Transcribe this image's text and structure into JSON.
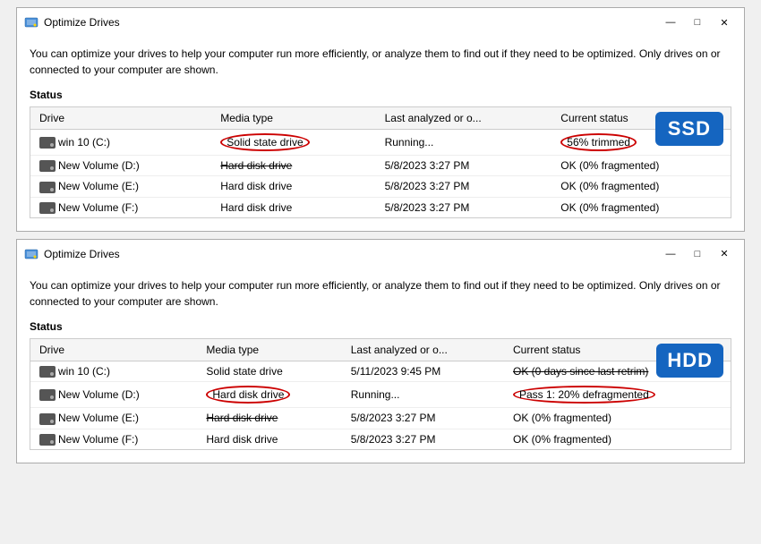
{
  "window1": {
    "title": "Optimize Drives",
    "description": "You can optimize your drives to help your computer run more efficiently, or analyze them to find out if they need to be optimized. Only drives on or connected to your computer are shown.",
    "section_label": "Status",
    "badge": "SSD",
    "columns": [
      "Drive",
      "Media type",
      "Last analyzed or o...",
      "Current status"
    ],
    "rows": [
      {
        "drive": "win 10 (C:)",
        "media_type": "Solid state drive",
        "last_analyzed": "Running...",
        "current_status": "56% trimmed",
        "circle_media": true,
        "circle_status": true
      },
      {
        "drive": "New Volume (D:)",
        "media_type": "Hard disk drive",
        "last_analyzed": "5/8/2023 3:27 PM",
        "current_status": "OK (0% fragmented)",
        "strikethrough_media": true,
        "circle_media": false,
        "circle_status": false
      },
      {
        "drive": "New Volume (E:)",
        "media_type": "Hard disk drive",
        "last_analyzed": "5/8/2023 3:27 PM",
        "current_status": "OK (0% fragmented)"
      },
      {
        "drive": "New Volume (F:)",
        "media_type": "Hard disk drive",
        "last_analyzed": "5/8/2023 3:27 PM",
        "current_status": "OK (0% fragmented)"
      }
    ]
  },
  "window2": {
    "title": "Optimize Drives",
    "description": "You can optimize your drives to help your computer run more efficiently, or analyze them to find out if they need to be optimized. Only drives on or connected to your computer are shown.",
    "section_label": "Status",
    "badge": "HDD",
    "columns": [
      "Drive",
      "Media type",
      "Last analyzed or o...",
      "Current status"
    ],
    "rows": [
      {
        "drive": "win 10 (C:)",
        "media_type": "Solid state drive",
        "last_analyzed": "5/11/2023 9:45 PM",
        "current_status": "OK (0 days since last retrim)",
        "strikethrough_status": true
      },
      {
        "drive": "New Volume (D:)",
        "media_type": "Hard disk drive",
        "last_analyzed": "Running...",
        "current_status": "Pass 1: 20% defragmented",
        "circle_media": true,
        "circle_status": true
      },
      {
        "drive": "New Volume (E:)",
        "media_type": "Hard disk drive",
        "last_analyzed": "5/8/2023 3:27 PM",
        "current_status": "OK (0% fragmented)",
        "strikethrough_media": true
      },
      {
        "drive": "New Volume (F:)",
        "media_type": "Hard disk drive",
        "last_analyzed": "5/8/2023 3:27 PM",
        "current_status": "OK (0% fragmented)"
      }
    ]
  },
  "controls": {
    "minimize": "—",
    "maximize": "□",
    "close": "✕"
  }
}
